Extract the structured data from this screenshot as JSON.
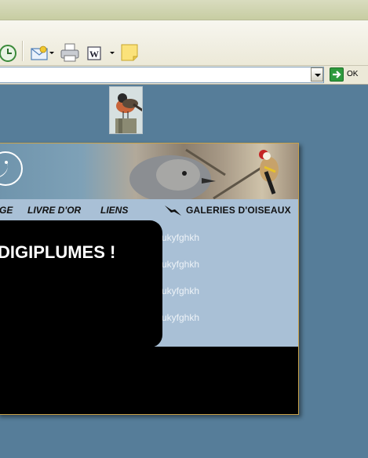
{
  "toolbar": {
    "icons": [
      "history-icon",
      "mail-icon",
      "print-icon",
      "edit-icon",
      "note-icon"
    ]
  },
  "address": {
    "value": "",
    "go_label": "OK"
  },
  "site": {
    "nav": [
      "GE",
      "LIVRE D'OR",
      "LIENS"
    ],
    "galleries": "GALERIES D'OISEAUX",
    "heading": "DIGIPLUMES !",
    "side_links": [
      "ukyfghkh",
      "ukyfghkh",
      "ukyfghkh",
      "ukyfghkh"
    ]
  },
  "colors": {
    "page_bg": "#567d99",
    "nav_bg": "#a9c0d6",
    "frame_border": "#c9a24a"
  }
}
